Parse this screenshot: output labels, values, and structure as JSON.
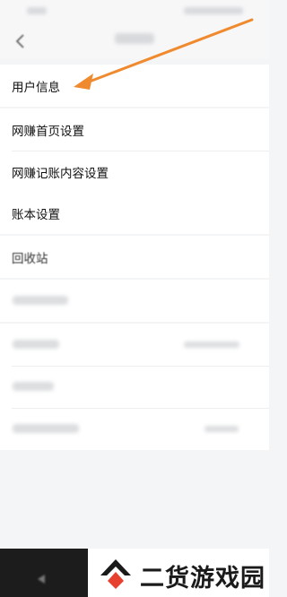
{
  "status_bar": {
    "left_text": "",
    "right_text": ""
  },
  "header": {
    "title": ""
  },
  "settings": {
    "group1": [
      {
        "label": "用户信息"
      }
    ],
    "group2": [
      {
        "label": "网赚首页设置"
      },
      {
        "label": "网赚记账内容设置"
      }
    ],
    "group3": [
      {
        "label": "账本设置"
      }
    ],
    "group4": [
      {
        "label": "回收站"
      }
    ],
    "blurred_rows": [
      {
        "label": "",
        "value": ""
      },
      {
        "label": "",
        "value": ""
      },
      {
        "label": "",
        "value": ""
      },
      {
        "label": "",
        "value": ""
      }
    ]
  },
  "watermark": {
    "text": "二货游戏园"
  },
  "colors": {
    "arrow": "#f08a2e",
    "background": "#f4f5f7",
    "card": "#ffffff",
    "bottom_bar": "#1c1c1c"
  },
  "icons": {
    "back": "chevron-left-icon",
    "row_chevron": "chevron-right-icon",
    "annotation": "arrow-annotation",
    "watermark_logo": "house-logo"
  }
}
